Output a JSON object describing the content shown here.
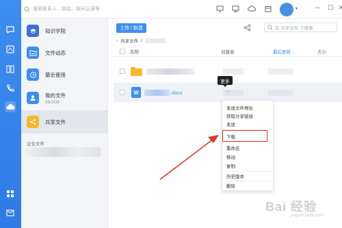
{
  "search": {
    "placeholder": "搜索联系人、群组、聊天记录等"
  },
  "nav": {
    "items": [
      {
        "label": "知识学院",
        "sub": ""
      },
      {
        "label": "文件动态",
        "sub": ""
      },
      {
        "label": "最近使用",
        "sub": ""
      },
      {
        "label": "我的文件",
        "sub": "0B/2GB"
      },
      {
        "label": "共享文件",
        "sub": ""
      }
    ],
    "org_label": "企业文件"
  },
  "toolbar": {
    "upload_label": "上传 / 新建",
    "search_placeholder": "在 共享文件 下搜索"
  },
  "breadcrumb": {
    "root": "共享文件",
    "sep": "/"
  },
  "table": {
    "headers": {
      "name": "名称",
      "creator": "创建者",
      "modified": "最后更新 ↓",
      "size": "大小"
    },
    "rows": [
      {
        "type": "folder",
        "name_suffix": ""
      },
      {
        "type": "docx",
        "name_suffix": ".docx"
      }
    ]
  },
  "tooltip": "更多",
  "more_label": "···",
  "menu": {
    "items": [
      "发送文件地址",
      "获取分享链接",
      "发送",
      "下载",
      "重命名",
      "移动",
      "复制",
      "历史版本",
      "删除"
    ]
  },
  "colors": {
    "accent": "#3d8ef0",
    "highlight": "#d9362b",
    "folder": "#f5b829"
  },
  "watermark": {
    "text": "Bai 经验",
    "sub": "jingyan.baidu.com"
  }
}
